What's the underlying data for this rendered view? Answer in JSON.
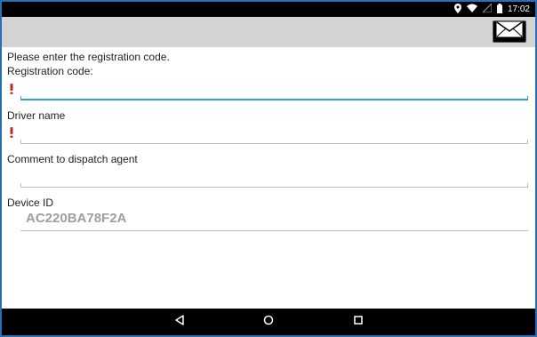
{
  "status_bar": {
    "time": "17:02",
    "icons": [
      "location-icon",
      "wifi-icon",
      "signal-icon",
      "battery-icon"
    ]
  },
  "action_bar": {
    "mail_icon": "envelope-icon"
  },
  "form": {
    "instruction": "Please enter the registration code.",
    "registration_label": "Registration code:",
    "registration_value": "",
    "driver_label": "Driver name",
    "driver_value": "",
    "comment_label": "Comment to dispatch agent",
    "comment_value": "",
    "device_label": "Device ID",
    "device_value": "AC220BA78F2A",
    "required_color": "#c62828",
    "focus_color": "#2fa0d8"
  },
  "nav_bar": {
    "buttons": [
      "back-icon",
      "home-icon",
      "recents-icon"
    ]
  }
}
